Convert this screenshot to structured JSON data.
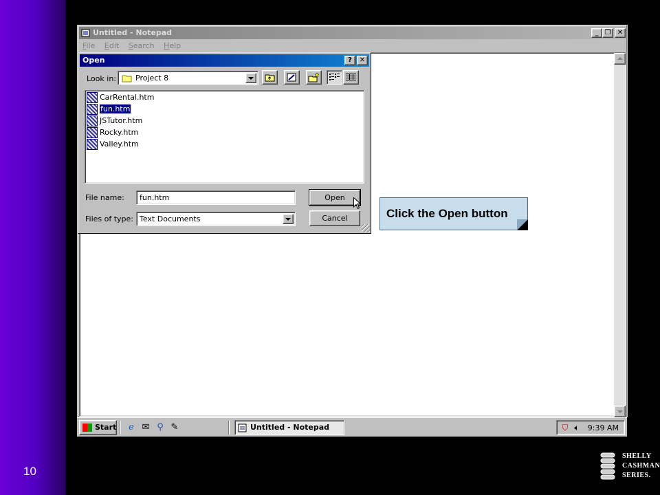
{
  "slide": {
    "number": "10"
  },
  "notepad": {
    "title": "Untitled - Notepad",
    "menu": [
      "File",
      "Edit",
      "Search",
      "Help"
    ]
  },
  "dialog": {
    "title": "Open",
    "look_in_label": "Look in:",
    "look_in_value": "Project 8",
    "files": [
      "CarRental.htm",
      "fun.htm",
      "JSTutor.htm",
      "Rocky.htm",
      "Valley.htm"
    ],
    "selected_file": "fun.htm",
    "file_name_label": "File name:",
    "file_name_value": "fun.htm",
    "files_of_type_label": "Files of type:",
    "files_of_type_value": "Text Documents",
    "open_label": "Open",
    "cancel_label": "Cancel"
  },
  "callout": {
    "text": "Click the Open button"
  },
  "taskbar": {
    "start_label": "Start",
    "task_label": "Untitled - Notepad",
    "clock": "9:39 AM"
  },
  "logo": {
    "lines": [
      "SHELLY",
      "CASHMAN",
      "SERIES."
    ]
  },
  "colors": {
    "title_active": "#000080",
    "title_inactive": "#808080",
    "sidebar": "#5a00c8",
    "callout_bg": "#c7ddeb"
  }
}
